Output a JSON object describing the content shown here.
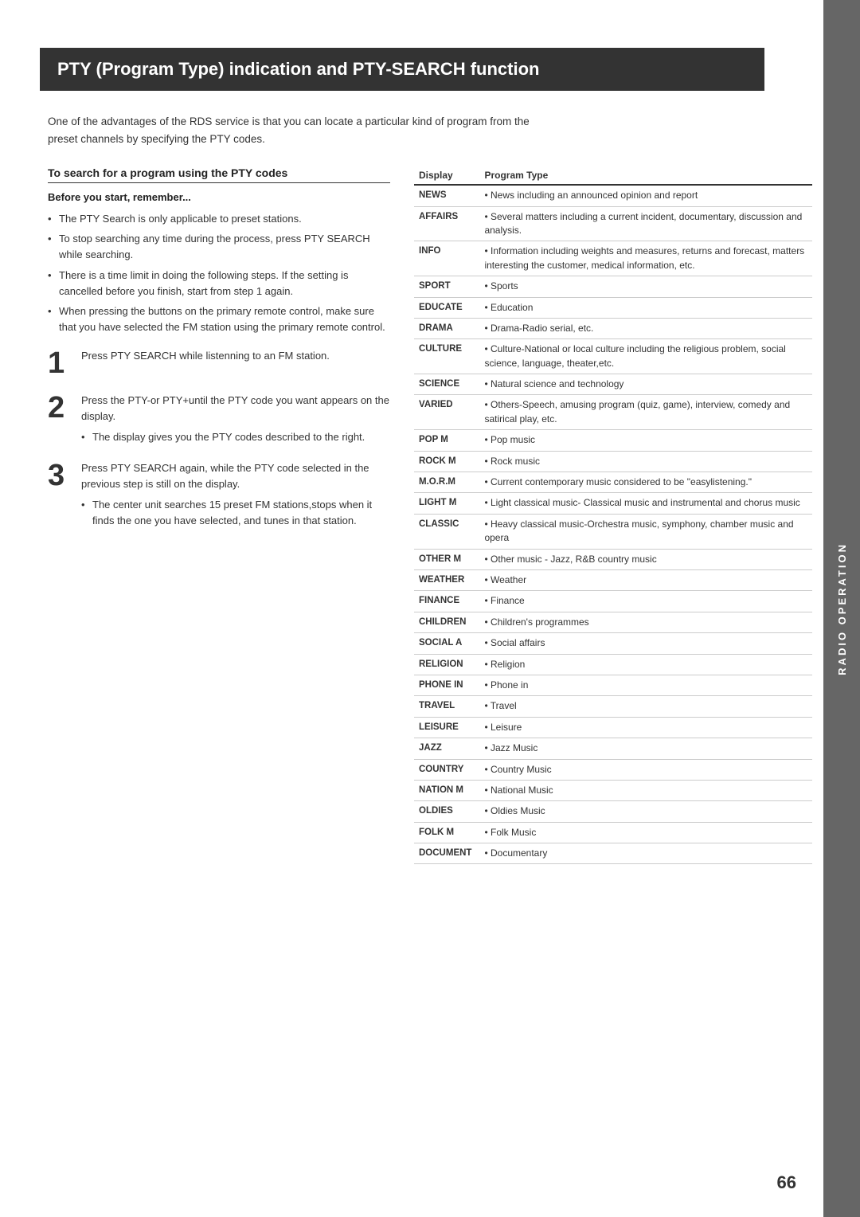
{
  "page": {
    "title": "PTY (Program Type) indication and PTY-SEARCH function",
    "page_number": "66",
    "side_label": "RADIO OPERATION"
  },
  "intro": {
    "text": "One  of the advantages of the RDS service is that you can locate a particular kind of program from the preset channels by specifying the PTY codes."
  },
  "search_section": {
    "heading": "To search for a program using the PTY codes",
    "sub_heading": "Before you start, remember...",
    "bullets": [
      "The PTY Search is only applicable to preset stations.",
      "To stop searching any time during the process, press PTY SEARCH while searching.",
      "There is a time limit in doing the following steps. If the setting is cancelled before you finish, start from step 1 again.",
      "When pressing the buttons on the primary remote control, make sure that you have selected the FM station using the primary remote control."
    ]
  },
  "steps": [
    {
      "number": "1",
      "text": "Press PTY SEARCH while listenning to an FM station."
    },
    {
      "number": "2",
      "text": "Press the PTY-or PTY+until the PTY code you want appears on the display.",
      "bullet": "The display gives you the PTY codes described to the right."
    },
    {
      "number": "3",
      "text": "Press PTY SEARCH again, while the PTY code selected in the previous step is still on the display.",
      "bullet": "The center unit searches 15 preset FM stations,stops when it finds the one you have selected, and tunes in that station."
    }
  ],
  "table": {
    "col_display": "Display",
    "col_type": "Program Type",
    "rows": [
      {
        "display": "NEWS",
        "type": "• News including an announced opinion and report"
      },
      {
        "display": "AFFAIRS",
        "type": "• Several matters including a current incident, documentary, discussion and analysis."
      },
      {
        "display": "INFO",
        "type": "• Information including weights and measures, returns and forecast, matters interesting the customer, medical information, etc."
      },
      {
        "display": "SPORT",
        "type": "• Sports"
      },
      {
        "display": "EDUCATE",
        "type": "• Education"
      },
      {
        "display": "DRAMA",
        "type": "• Drama-Radio serial, etc."
      },
      {
        "display": "CULTURE",
        "type": "• Culture-National or local culture including the religious problem, social science, language, theater,etc."
      },
      {
        "display": "SCIENCE",
        "type": "• Natural science and technology"
      },
      {
        "display": "VARIED",
        "type": "• Others-Speech, amusing program (quiz, game), interview, comedy and satirical play, etc."
      },
      {
        "display": "POP M",
        "type": "• Pop music"
      },
      {
        "display": "ROCK M",
        "type": "• Rock music"
      },
      {
        "display": "M.O.R.M",
        "type": "• Current contemporary music considered to be \"easylistening.\""
      },
      {
        "display": "LIGHT M",
        "type": "• Light classical music- Classical music and instrumental and chorus music"
      },
      {
        "display": "CLASSIC",
        "type": "• Heavy classical  music-Orchestra music, symphony, chamber music and opera"
      },
      {
        "display": "OTHER M",
        "type": "• Other music - Jazz, R&B country music"
      },
      {
        "display": "WEATHER",
        "type": "• Weather"
      },
      {
        "display": "FINANCE",
        "type": "• Finance"
      },
      {
        "display": "CHILDREN",
        "type": "• Children's programmes"
      },
      {
        "display": "SOCIAL A",
        "type": "• Social affairs"
      },
      {
        "display": "RELIGION",
        "type": "• Religion"
      },
      {
        "display": "PHONE IN",
        "type": "• Phone in"
      },
      {
        "display": "TRAVEL",
        "type": "• Travel"
      },
      {
        "display": "LEISURE",
        "type": "• Leisure"
      },
      {
        "display": "JAZZ",
        "type": "• Jazz Music"
      },
      {
        "display": "COUNTRY",
        "type": "• Country Music"
      },
      {
        "display": "NATION M",
        "type": "• National Music"
      },
      {
        "display": "OLDIES",
        "type": "• Oldies Music"
      },
      {
        "display": "FOLK M",
        "type": "• Folk Music"
      },
      {
        "display": "DOCUMENT",
        "type": "• Documentary"
      }
    ]
  }
}
